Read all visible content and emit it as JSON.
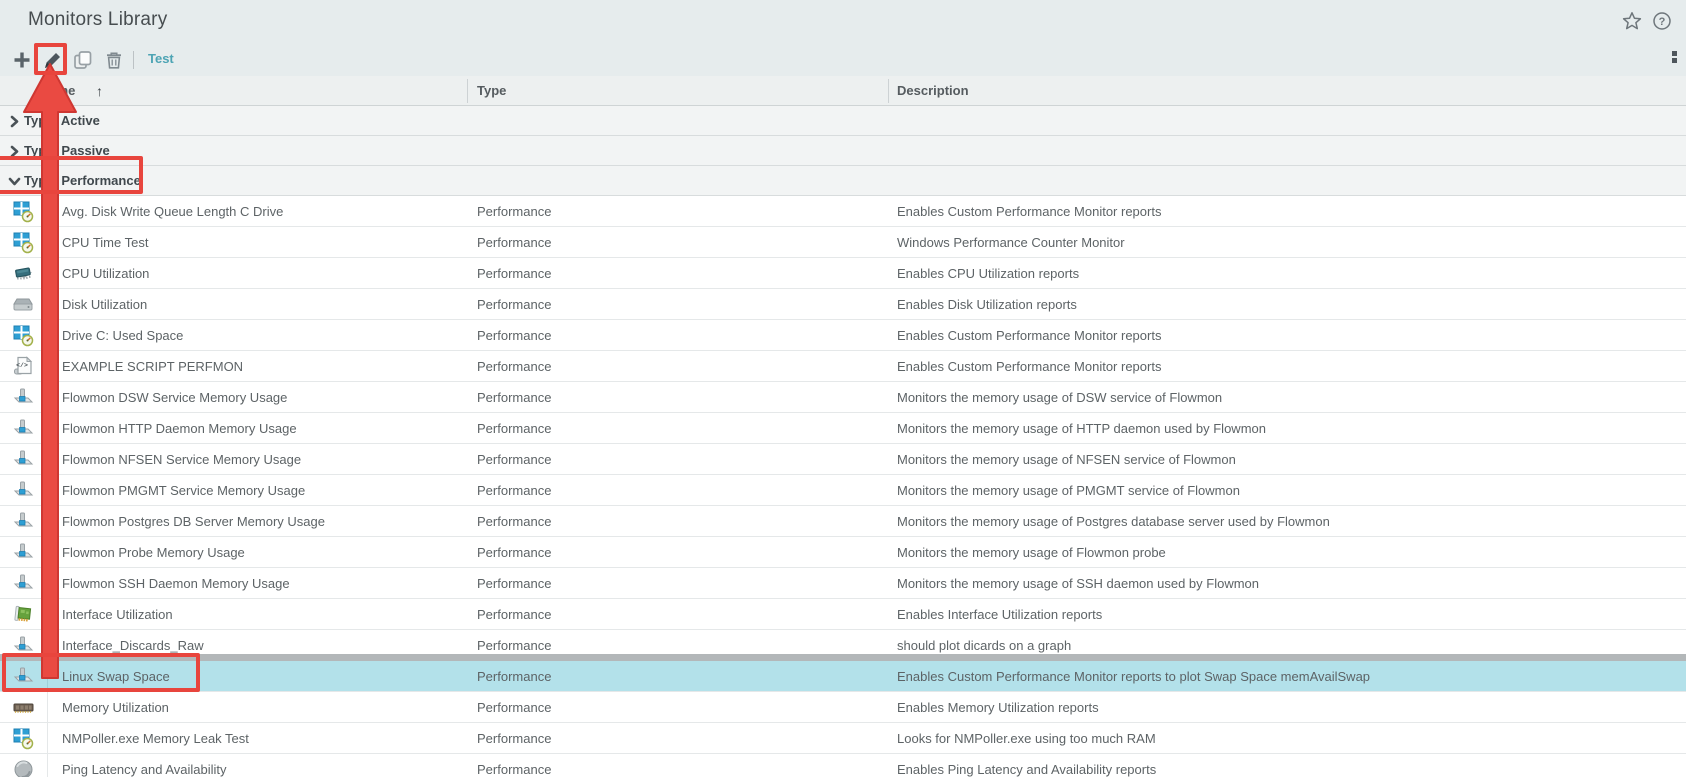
{
  "window": {
    "title": "Monitors Library"
  },
  "title_icons": {
    "favorite": "star-outline",
    "help": "question-mark-circle",
    "more": "kebab-handle"
  },
  "toolbar": {
    "add_label": "Add",
    "edit_label": "Edit",
    "copy_label": "Copy",
    "delete_label": "Delete",
    "test_label": "Test"
  },
  "table": {
    "columns": [
      {
        "label": "Name",
        "sorted": "asc"
      },
      {
        "label": "Type"
      },
      {
        "label": "Description"
      }
    ],
    "sort_arrow": "↑",
    "groups": [
      {
        "label": "Type: Active",
        "expanded": false
      },
      {
        "label": "Type: Passive",
        "expanded": false
      },
      {
        "label": "Type: Performance",
        "expanded": true
      }
    ],
    "rows": [
      {
        "icon": "windows-performance",
        "name": "Avg. Disk Write Queue Length C Drive",
        "type": "Performance",
        "description": "Enables Custom Performance Monitor reports",
        "selected": false
      },
      {
        "icon": "windows-performance",
        "name": "CPU Time Test",
        "type": "Performance",
        "description": "Windows Performance Counter Monitor",
        "selected": false
      },
      {
        "icon": "cpu",
        "name": "CPU Utilization",
        "type": "Performance",
        "description": "Enables CPU Utilization reports",
        "selected": false
      },
      {
        "icon": "disk",
        "name": "Disk Utilization",
        "type": "Performance",
        "description": "Enables Disk Utilization reports",
        "selected": false
      },
      {
        "icon": "windows-performance",
        "name": "Drive C: Used Space",
        "type": "Performance",
        "description": "Enables Custom Performance Monitor reports",
        "selected": false
      },
      {
        "icon": "script",
        "name": "EXAMPLE SCRIPT PERFMON",
        "type": "Performance",
        "description": "Enables Custom Performance Monitor reports",
        "selected": false
      },
      {
        "icon": "network-tap",
        "name": "Flowmon DSW Service Memory Usage",
        "type": "Performance",
        "description": "Monitors the memory usage of DSW service of Flowmon",
        "selected": false
      },
      {
        "icon": "network-tap",
        "name": "Flowmon HTTP Daemon Memory Usage",
        "type": "Performance",
        "description": "Monitors the memory usage of HTTP daemon used by Flowmon",
        "selected": false
      },
      {
        "icon": "network-tap",
        "name": "Flowmon NFSEN Service Memory Usage",
        "type": "Performance",
        "description": "Monitors the memory usage of NFSEN service of Flowmon",
        "selected": false
      },
      {
        "icon": "network-tap",
        "name": "Flowmon PMGMT Service Memory Usage",
        "type": "Performance",
        "description": "Monitors the memory usage of PMGMT service of Flowmon",
        "selected": false
      },
      {
        "icon": "network-tap",
        "name": "Flowmon Postgres DB Server Memory Usage",
        "type": "Performance",
        "description": "Monitors the memory usage of Postgres database server used by Flowmon",
        "selected": false
      },
      {
        "icon": "network-tap",
        "name": "Flowmon Probe Memory Usage",
        "type": "Performance",
        "description": "Monitors the memory usage of Flowmon probe",
        "selected": false
      },
      {
        "icon": "network-tap",
        "name": "Flowmon SSH Daemon Memory Usage",
        "type": "Performance",
        "description": "Monitors the memory usage of SSH daemon used by Flowmon",
        "selected": false
      },
      {
        "icon": "nic",
        "name": "Interface Utilization",
        "type": "Performance",
        "description": "Enables Interface Utilization reports",
        "selected": false
      },
      {
        "icon": "network-tap",
        "name": "Interface_Discards_Raw",
        "type": "Performance",
        "description": "should plot dicards on a graph",
        "selected": false
      },
      {
        "icon": "network-tap",
        "name": "Linux Swap Space",
        "type": "Performance",
        "description": "Enables Custom Performance Monitor reports to plot Swap Space memAvailSwap",
        "selected": true
      },
      {
        "icon": "ram",
        "name": "Memory Utilization",
        "type": "Performance",
        "description": "Enables Memory Utilization reports",
        "selected": false
      },
      {
        "icon": "windows-performance",
        "name": "NMPoller.exe Memory Leak Test",
        "type": "Performance",
        "description": "Looks for NMPoller.exe using too much RAM",
        "selected": false
      },
      {
        "icon": "ping",
        "name": "Ping Latency and Availability",
        "type": "Performance",
        "description": "Enables Ping Latency and Availability reports",
        "selected": false
      }
    ]
  },
  "annotations": {
    "color": "#e8453d",
    "highlight_boxes": [
      "edit-button",
      "type-performance-group",
      "linux-swap-space-row"
    ],
    "arrow": {
      "from": "linux-swap-space-row",
      "to": "edit-button"
    }
  },
  "colors": {
    "selected_row": "#b3e1ea",
    "link_teal": "#4da4b4",
    "chrome_background": "#e6eced"
  }
}
